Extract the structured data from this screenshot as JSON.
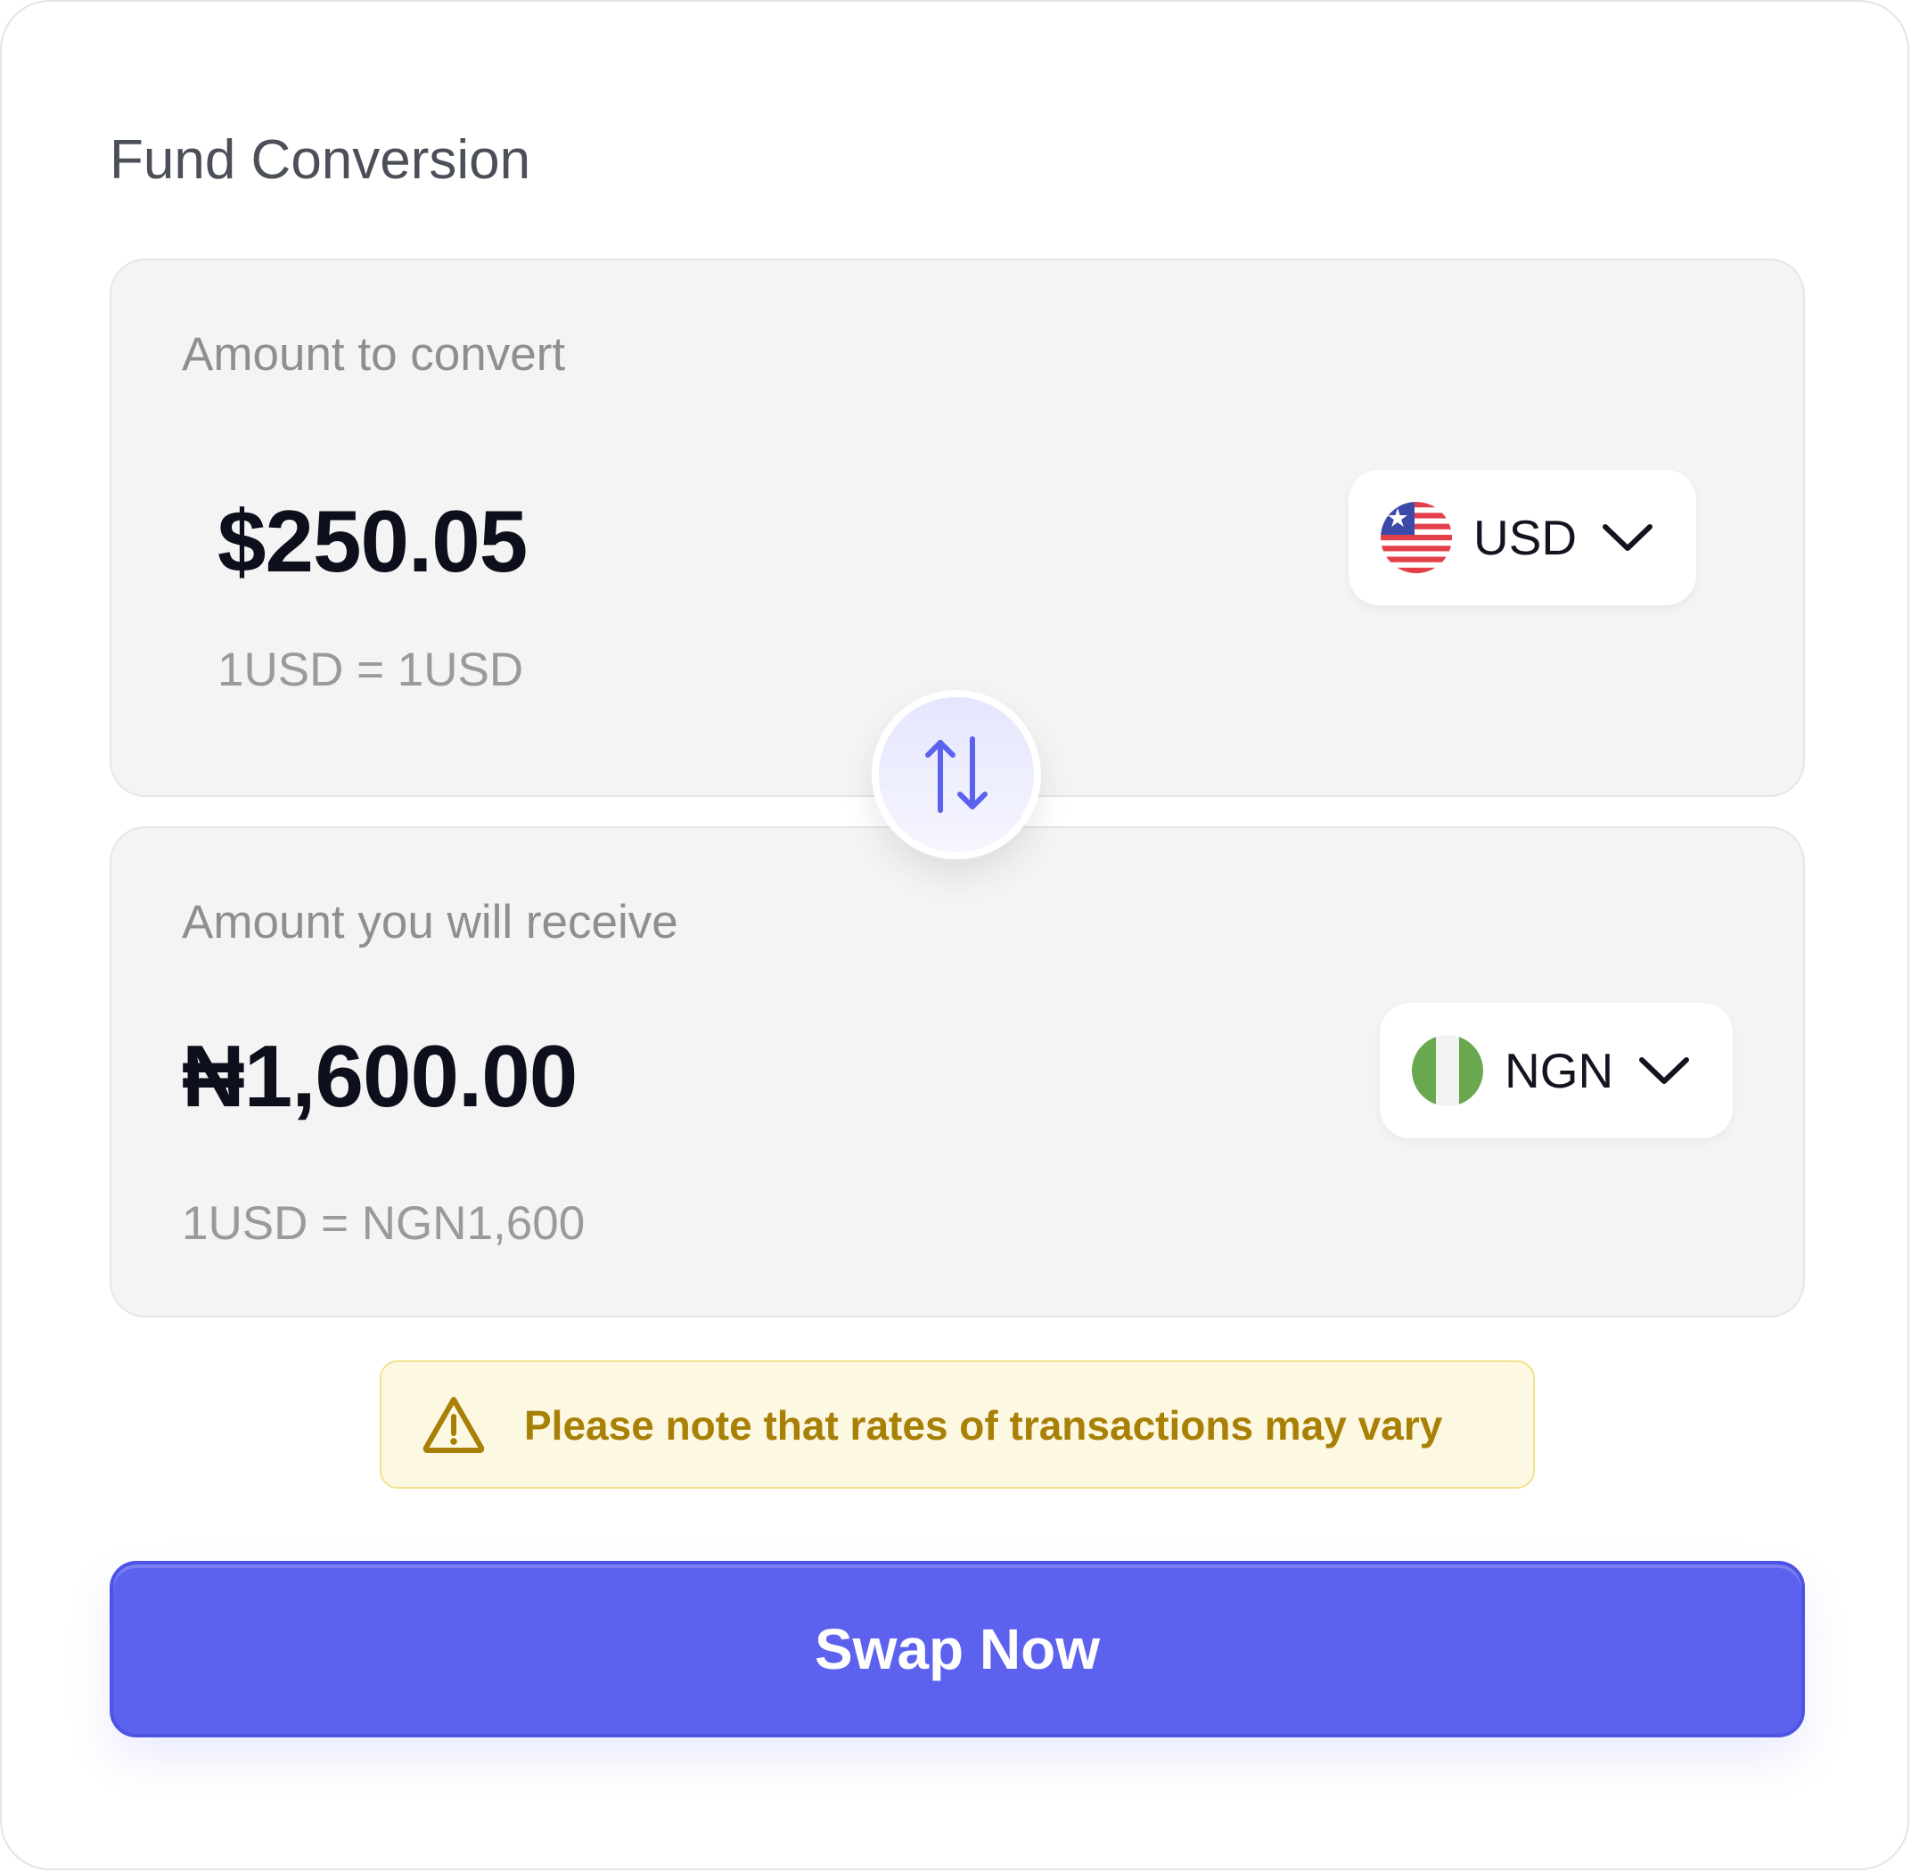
{
  "title": "Fund Conversion",
  "from": {
    "label": "Amount to convert",
    "amount": "$250.05",
    "rate": "1USD = 1USD",
    "currency": {
      "code": "USD",
      "flag_icon": "us-flag-icon"
    }
  },
  "to": {
    "label": "Amount you will receive",
    "amount": "₦1,600.00",
    "rate": "1USD = NGN1,600",
    "currency": {
      "code": "NGN",
      "flag_icon": "ng-flag-icon"
    }
  },
  "swap_icon": "swap-arrows-icon",
  "notice": {
    "text": "Please note that rates of transactions may vary",
    "icon": "warning-icon"
  },
  "action": {
    "label": "Swap Now"
  },
  "colors": {
    "accent": "#5c62ee",
    "warning_text": "#a88006",
    "warning_bg": "#fdf8e1",
    "amount_text": "#0d0f1c"
  }
}
